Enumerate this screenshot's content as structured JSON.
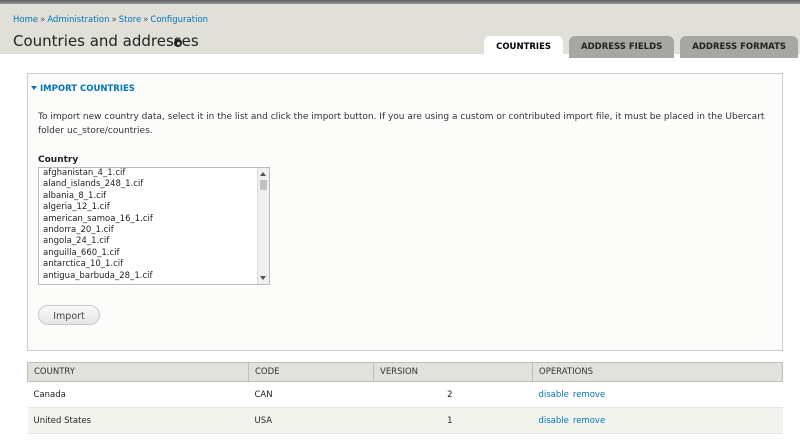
{
  "breadcrumb": [
    {
      "label": "Home"
    },
    {
      "label": "Administration"
    },
    {
      "label": "Store"
    },
    {
      "label": "Configuration"
    }
  ],
  "breadcrumb_separator": "»",
  "page": {
    "title": "Countries and addresses"
  },
  "tabs": [
    {
      "label": "COUNTRIES",
      "active": true
    },
    {
      "label": "ADDRESS FIELDS",
      "active": false
    },
    {
      "label": "ADDRESS FORMATS",
      "active": false
    }
  ],
  "import": {
    "legend": "IMPORT COUNTRIES",
    "description": "To import new country data, select it in the list and click the import button. If you are using a custom or contributed import file, it must be placed in the Ubercart folder uc_store/countries.",
    "field_label": "Country",
    "options": [
      "afghanistan_4_1.cif",
      "aland_islands_248_1.cif",
      "albania_8_1.cif",
      "algeria_12_1.cif",
      "american_samoa_16_1.cif",
      "andorra_20_1.cif",
      "angola_24_1.cif",
      "anguilla_660_1.cif",
      "antarctica_10_1.cif",
      "antigua_barbuda_28_1.cif"
    ],
    "button_label": "Import"
  },
  "table": {
    "headers": {
      "country": "COUNTRY",
      "code": "CODE",
      "version": "VERSION",
      "operations": "OPERATIONS"
    },
    "rows": [
      {
        "country": "Canada",
        "code": "CAN",
        "version": "2",
        "op1": "disable",
        "op2": "remove"
      },
      {
        "country": "United States",
        "code": "USA",
        "version": "1",
        "op1": "disable",
        "op2": "remove"
      }
    ]
  },
  "colors": {
    "link": "#0074bd",
    "header_bg": "#e0e0d8",
    "tab_inactive": "#a6a7a2"
  }
}
